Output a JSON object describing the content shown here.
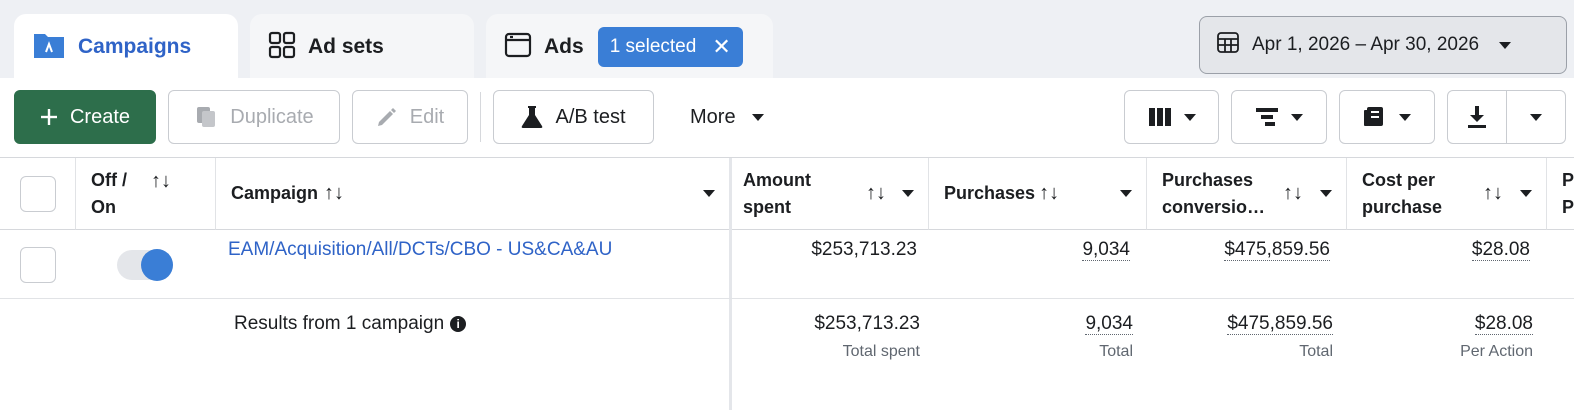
{
  "tabs": {
    "campaigns": "Campaigns",
    "adsets": "Ad sets",
    "ads": "Ads",
    "ads_badge": "1 selected"
  },
  "date_range": "Apr 1, 2026 – Apr 30, 2026",
  "toolbar": {
    "create": "Create",
    "duplicate": "Duplicate",
    "edit": "Edit",
    "ab_test": "A/B test",
    "more": "More"
  },
  "columns": {
    "off_on": [
      "Off /",
      "On"
    ],
    "campaign": "Campaign",
    "amount_spent": [
      "Amount",
      "spent"
    ],
    "purchases": "Purchases",
    "purchases_conv": [
      "Purchases",
      "conversio…"
    ],
    "cost_per_purchase": [
      "Cost per",
      "purchase"
    ],
    "cut": [
      "P",
      "P"
    ]
  },
  "row": {
    "campaign_name": "EAM/Acquisition/All/DCTs/CBO - US&CA&AU",
    "toggle_on": true,
    "amount_spent": "$253,713.23",
    "purchases": "9,034",
    "purchases_conv": "$475,859.56",
    "cost_per_purchase": "$28.08"
  },
  "summary": {
    "label": "Results from 1 campaign",
    "amount_spent": "$253,713.23",
    "amount_spent_sub": "Total spent",
    "purchases": "9,034",
    "purchases_sub": "Total",
    "purchases_conv": "$475,859.56",
    "purchases_conv_sub": "Total",
    "cost_per_purchase": "$28.08",
    "cost_per_purchase_sub": "Per Action"
  },
  "colors": {
    "accent": "#2f63c7",
    "create": "#2d6e4b",
    "badge": "#3a7ed6"
  }
}
